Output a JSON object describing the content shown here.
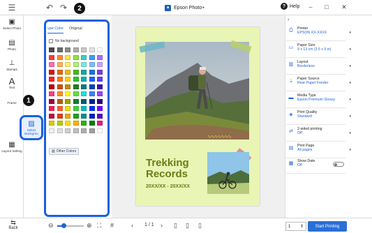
{
  "titlebar": {
    "app_title": "Epson Photo+",
    "help_label": "Help",
    "icons": [
      "menu-icon",
      "undo-icon",
      "redo-icon",
      "minimize-icon",
      "maximize-icon",
      "close-icon"
    ]
  },
  "left_tools": [
    {
      "label": "Select Photo",
      "icon": "select-photo-icon"
    },
    {
      "label": "Photo",
      "icon": "photo-icon"
    },
    {
      "label": "Stamps",
      "icon": "stamps-icon"
    },
    {
      "label": "Text",
      "icon": "text-icon"
    },
    {
      "label": "Frame",
      "icon": "frame-icon"
    },
    {
      "label": "Select Backgrou",
      "icon": "background-icon"
    },
    {
      "label": "Layout Setting",
      "icon": "layout-icon"
    }
  ],
  "callouts": {
    "one": "1",
    "two": "2"
  },
  "background_panel": {
    "tabs": [
      "ype Color",
      "Original"
    ],
    "no_background_label": "No background",
    "other_colors_label": "Other Colors",
    "swatch_colors": [
      "#4a4a4a",
      "#6b6b6b",
      "#8c8c8c",
      "#adadad",
      "#c8c8c8",
      "#e2e2e2",
      "#ffffff",
      "#ff3a3a",
      "#ff8a2a",
      "#ffe23a",
      "#8ee04a",
      "#3ad0c0",
      "#3a9cff",
      "#b06aff",
      "#ff6ab4",
      "#ffb15a",
      "#fff06a",
      "#aef07a",
      "#7ae8e0",
      "#7abcff",
      "#cfa0ff",
      "#d01818",
      "#e06a10",
      "#e0c010",
      "#44b820",
      "#10a898",
      "#1870e0",
      "#8038e0",
      "#ff2020",
      "#ff7a00",
      "#ffd000",
      "#30c030",
      "#00b0b0",
      "#2060ff",
      "#6040ff",
      "#c00000",
      "#d05000",
      "#c09000",
      "#208020",
      "#008080",
      "#0040c0",
      "#4010b0",
      "#ff4080",
      "#ff9020",
      "#ffff20",
      "#60e040",
      "#20e0e0",
      "#4080ff",
      "#a040ff",
      "#a00040",
      "#b06010",
      "#a0a000",
      "#108030",
      "#006070",
      "#002090",
      "#300080",
      "#ff1a5a",
      "#ff6020",
      "#f0e000",
      "#40d040",
      "#00c0c0",
      "#0030ff",
      "#8000ff",
      "#c01040",
      "#e04010",
      "#e0b000",
      "#20a020",
      "#009090",
      "#0020c0",
      "#6000c0",
      "#d0d000",
      "#b0d000",
      "#ffe000",
      "#ffb000",
      "#30b000",
      "#008000",
      "#e02080",
      "#f0f0f0",
      "#e0e0e0",
      "#d0d0d0",
      "#c0c0c0",
      "#b0b0b0",
      "#a0a0a0",
      "#ffffff"
    ]
  },
  "page": {
    "title_line1": "Trekking",
    "title_line2": "Records",
    "date_range": "20XX/XX - 20XX/XX"
  },
  "settings": [
    {
      "label": "Printer",
      "value": "EPSON XX-XXXX",
      "icon": "printer-icon"
    },
    {
      "label": "Paper Size",
      "value": "9 x 13 cm (3.5 x 5 in)",
      "icon": "paper-size-icon"
    },
    {
      "label": "Layout",
      "value": "Borderless",
      "icon": "layout-icon"
    },
    {
      "label": "Paper Source",
      "value": "Rear Paper Feeder",
      "icon": "paper-source-icon"
    },
    {
      "label": "Media Type",
      "value": "Epson Premium Glossy",
      "icon": "media-type-icon"
    },
    {
      "label": "Print Quality",
      "value": "Standard",
      "icon": "print-quality-icon"
    },
    {
      "label": "2-sided printing",
      "value": "Off",
      "icon": "two-sided-icon"
    },
    {
      "label": "Print Page",
      "value": "All pages",
      "icon": "print-page-icon"
    },
    {
      "label": "Show Date",
      "value": "Off",
      "icon": "show-date-icon"
    }
  ],
  "bottombar": {
    "back_label": "Back",
    "page_indicator": "1 / 1",
    "copies": "1",
    "start_print_label": "Start Printing"
  },
  "colors": {
    "accent": "#1a5fe0",
    "page_bg": "#e8f5b5",
    "title_green": "#6b7d13"
  }
}
